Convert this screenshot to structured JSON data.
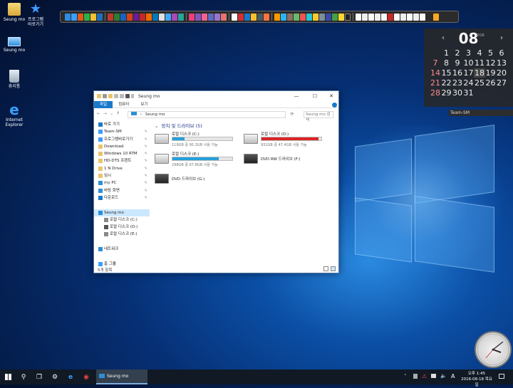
{
  "desktop": {
    "icons": [
      {
        "label": "Seung mo",
        "label2": ""
      },
      {
        "label": "프로그램",
        "label2": "바로가기"
      },
      {
        "label": "Seung mo",
        "label2": ""
      },
      {
        "label": "휴지통",
        "label2": ""
      },
      {
        "label": "Internet",
        "label2": "Explorer"
      }
    ]
  },
  "calendar": {
    "month": "08",
    "year_month_small": "2016",
    "prev": "‹",
    "next": "›",
    "days": [
      "",
      "1",
      "2",
      "3",
      "4",
      "5",
      "6",
      "7",
      "8",
      "9",
      "10",
      "11",
      "12",
      "13",
      "14",
      "15",
      "16",
      "17",
      "18",
      "19",
      "20",
      "21",
      "22",
      "23",
      "24",
      "25",
      "26",
      "27",
      "28",
      "29",
      "30",
      "31"
    ],
    "today": "18",
    "team_label": "Team-SM"
  },
  "explorer": {
    "title": "Seung mo",
    "ribbon_tabs": [
      "파일",
      "컴퓨터",
      "보기"
    ],
    "address": "Seung mo",
    "search_placeholder": "Seung mo 검색",
    "nav": [
      {
        "label": "바로 가기",
        "pin": ""
      },
      {
        "label": "Team-SM",
        "pin": "✎"
      },
      {
        "label": "프로그램바로가기",
        "pin": "✎"
      },
      {
        "label": "Download",
        "pin": "✎"
      },
      {
        "label": "Windows 10 RTM",
        "pin": "✎"
      },
      {
        "label": "HD-DTS 프렌트",
        "pin": "✎"
      },
      {
        "label": "1 N Drive",
        "pin": "✎"
      },
      {
        "label": "임시",
        "pin": "✎"
      },
      {
        "label": "my PC",
        "pin": "✎"
      },
      {
        "label": "바탕 화면",
        "pin": "✎"
      },
      {
        "label": "다운로드",
        "pin": "✎"
      },
      {
        "label": "",
        "pin": ""
      },
      {
        "label": "Seung mo",
        "pin": ""
      },
      {
        "label": "로컬 디스크 (C:)",
        "pin": ""
      },
      {
        "label": "로컬 디스크 (D:)",
        "pin": ""
      },
      {
        "label": "로컬 디스크 (E:)",
        "pin": ""
      },
      {
        "label": "",
        "pin": ""
      },
      {
        "label": "네트워크",
        "pin": ""
      },
      {
        "label": "",
        "pin": ""
      },
      {
        "label": "홈 그룹",
        "pin": ""
      }
    ],
    "section_title": "장치 및 드라이브 (5)",
    "drives": [
      {
        "name": "로컬 디스크 (C:)",
        "sub": "119GB 중 95.3GB 사용 가능",
        "used": 0.2,
        "color": "#26a0da"
      },
      {
        "name": "로컬 디스크 (D:)",
        "sub": "931GB 중 47.4GB 사용 가능",
        "used": 0.95,
        "color": "#da2626"
      },
      {
        "name": "로컬 디스크 (E:)",
        "sub": "298GB 중 67.8GB 사용 가능",
        "used": 0.77,
        "color": "#26a0da"
      },
      {
        "name": "DVD RW 드라이브 (F:)",
        "sub": "",
        "used": null,
        "color": ""
      },
      {
        "name": "DVD 드라이브 (G:)",
        "sub": "",
        "used": null,
        "color": ""
      }
    ],
    "status": "5개 항목"
  },
  "taskbar": {
    "app_label": "Seung mo",
    "time": "오후 1:45",
    "date": "2016-08-18 목요일",
    "ime": "A"
  }
}
